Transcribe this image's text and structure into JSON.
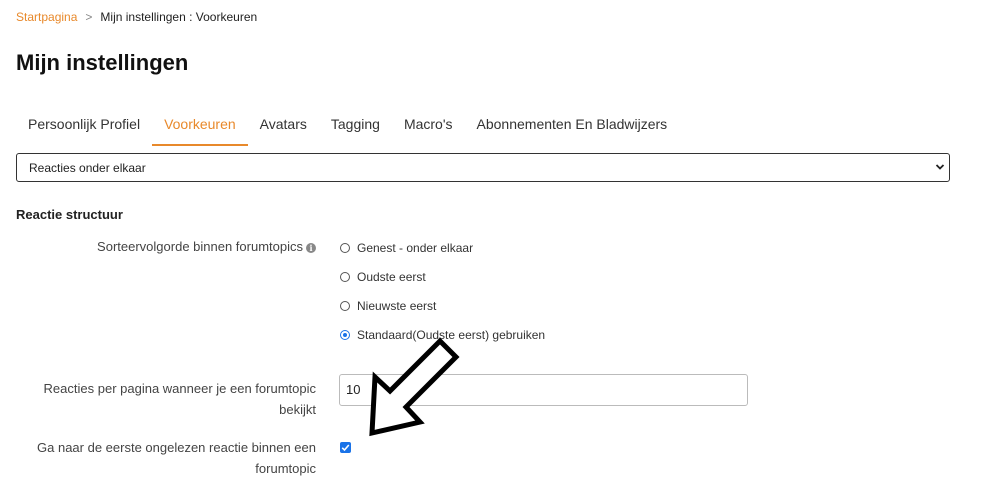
{
  "breadcrumb": {
    "home": "Startpagina",
    "separator": ">",
    "current": "Mijn instellingen : Voorkeuren"
  },
  "page_title": "Mijn instellingen",
  "tabs": [
    {
      "label": "Persoonlijk Profiel",
      "active": false
    },
    {
      "label": "Voorkeuren",
      "active": true
    },
    {
      "label": "Avatars",
      "active": false
    },
    {
      "label": "Tagging",
      "active": false
    },
    {
      "label": "Macro's",
      "active": false
    },
    {
      "label": "Abonnementen En Bladwijzers",
      "active": false
    }
  ],
  "view_select": {
    "selected": "Reacties onder elkaar",
    "icon": "chevron-down-icon"
  },
  "section": {
    "title": "Reactie structuur"
  },
  "sort_order": {
    "label": "Sorteervolgorde binnen forumtopics",
    "info_icon": "info-icon",
    "options": [
      {
        "label": "Genest - onder elkaar",
        "checked": false
      },
      {
        "label": "Oudste eerst",
        "checked": false
      },
      {
        "label": "Nieuwste eerst",
        "checked": false
      },
      {
        "label": "Standaard(Oudste eerst) gebruiken",
        "checked": true
      }
    ]
  },
  "replies_per_page": {
    "label_line1": "Reacties per pagina wanneer je een forumtopic",
    "label_line2": "bekijkt",
    "value": "10"
  },
  "first_unread": {
    "label_line1": "Ga naar de eerste ongelezen reactie binnen een",
    "label_line2": "forumtopic",
    "checked": true
  },
  "colors": {
    "accent": "#e8892b",
    "control_blue": "#1a73e8",
    "annotation": "#000000"
  },
  "annotation": {
    "icon": "arrow-pointing-down-left-icon"
  }
}
